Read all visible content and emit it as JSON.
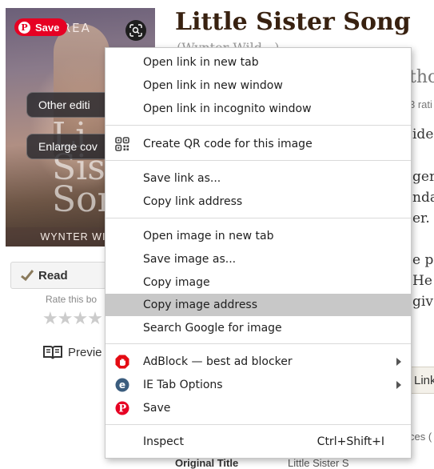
{
  "book": {
    "title": "Little Sister Song",
    "series": "(Wynter Wild...)",
    "cover": {
      "series_text": "S CREA",
      "big_text": "Little\nSister\nSong",
      "author": "WYNTER WILD"
    },
    "pinterest_save": "Save",
    "overlay_buttons": [
      "Other editi",
      "Enlarge cov"
    ],
    "read_label": "Read",
    "rate_label": "Rate this bo",
    "preview_label": "Previe",
    "right_fragments": [
      "tho",
      "3 rati",
      "ide",
      "ger",
      "ndal",
      "er.",
      "e pe",
      "He a",
      "giv"
    ],
    "link_button": "Link",
    "aside": "ces (",
    "original_title_label": "Original Title",
    "original_title_value": "Little Sister S"
  },
  "context_menu": {
    "items": [
      {
        "label": "Open link in new tab"
      },
      {
        "label": "Open link in new window"
      },
      {
        "label": "Open link in incognito window"
      },
      {
        "label": "Create QR code for this image",
        "icon": "qr-code-icon"
      },
      {
        "label": "Save link as..."
      },
      {
        "label": "Copy link address"
      },
      {
        "label": "Open image in new tab"
      },
      {
        "label": "Save image as..."
      },
      {
        "label": "Copy image"
      },
      {
        "label": "Copy image address",
        "highlighted": true
      },
      {
        "label": "Search Google for image"
      },
      {
        "label": "AdBlock — best ad blocker",
        "icon": "adblock-icon",
        "submenu": true
      },
      {
        "label": "IE Tab Options",
        "icon": "ie-tab-icon",
        "submenu": true
      },
      {
        "label": "Save",
        "icon": "pinterest-icon"
      },
      {
        "label": "Inspect",
        "shortcut": "Ctrl+Shift+I"
      }
    ]
  },
  "colors": {
    "menu_highlight": "#c8c8c8",
    "pinterest_red": "#e60023",
    "adblock_red": "#e40b13",
    "ie_tab_blue": "#3b5d7e",
    "title_brown": "#382110"
  }
}
